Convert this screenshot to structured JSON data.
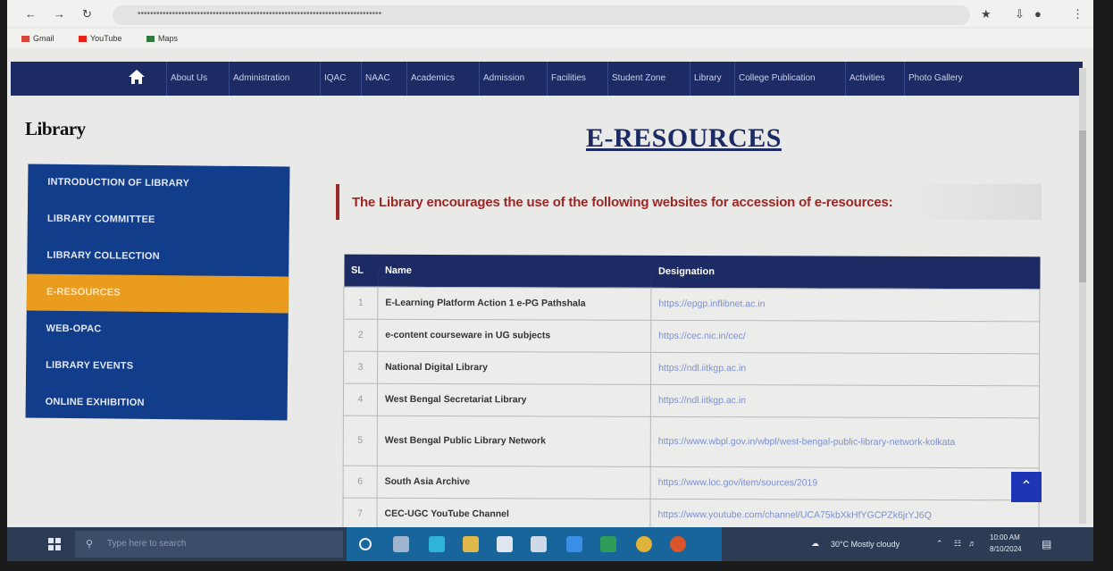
{
  "browser": {
    "url": "••••••••••••••••••••••••••••••••••••••••••••••••••••••••••••••••••••••••••••••",
    "bookmarks": [
      "Gmail",
      "YouTube",
      "Maps"
    ]
  },
  "nav": {
    "items": [
      "About Us",
      "Administration",
      "IQAC",
      "NAAC",
      "Academics",
      "Admission",
      "Facilities",
      "Student Zone",
      "Library",
      "College Publication",
      "Activities",
      "Photo Gallery"
    ]
  },
  "sidebar": {
    "title": "Library",
    "items": [
      {
        "label": "INTRODUCTION OF LIBRARY"
      },
      {
        "label": "LIBRARY COMMITTEE"
      },
      {
        "label": "LIBRARY COLLECTION"
      },
      {
        "label": "E-RESOURCES"
      },
      {
        "label": "WEB-OPAC"
      },
      {
        "label": "LIBRARY EVENTS"
      },
      {
        "label": "ONLINE EXHIBITION"
      }
    ],
    "active_index": 3
  },
  "main": {
    "heading": "E-RESOURCES",
    "intro": "The Library encourages the use of the following websites for accession of e-resources:",
    "table": {
      "headers": [
        "SL",
        "Name",
        "Designation"
      ],
      "rows": [
        {
          "sl": "1",
          "name": "E-Learning Platform Action 1 e-PG Pathshala",
          "url": "https://epgp.inflibnet.ac.in"
        },
        {
          "sl": "2",
          "name": "e-content courseware in UG subjects",
          "url": "https://cec.nic.in/cec/"
        },
        {
          "sl": "3",
          "name": "National Digital Library",
          "url": "https://ndl.iitkgp.ac.in"
        },
        {
          "sl": "4",
          "name": "West Bengal Secretariat Library",
          "url": "https://ndl.iitkgp.ac.in"
        },
        {
          "sl": "5",
          "name": "West Bengal Public Library Network",
          "url": "https://www.wbpl.gov.in/wbpl/west-bengal-public-library-network-kolkata"
        },
        {
          "sl": "6",
          "name": "South Asia Archive",
          "url": "https://www.loc.gov/item/sources/2019"
        },
        {
          "sl": "7",
          "name": "CEC-UGC YouTube Channel",
          "url": "https://www.youtube.com/channel/UCA75kbXkHfYGCPZk6jrYJ6Q"
        }
      ]
    }
  },
  "taskbar": {
    "search_placeholder": "Type here to search",
    "weather": "30°C  Mostly cloudy",
    "time": "10:00 AM",
    "date": "8/10/2024"
  },
  "colors": {
    "nav_bg": "#1c2b63",
    "sidebar_bg": "#123d8a",
    "active_item": "#e99c1e",
    "intro_text": "#9c2626",
    "scroll_top_button": "#1d36b5"
  }
}
